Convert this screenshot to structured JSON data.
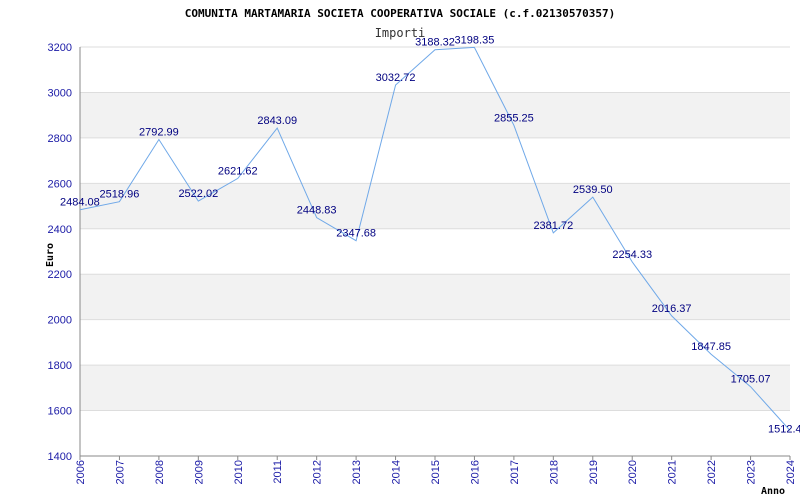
{
  "chart_data": {
    "type": "line",
    "title": "COMUNITA MARTAMARIA SOCIETA COOPERATIVA SOCIALE (c.f.02130570357)",
    "subtitle": "Importi",
    "xlabel": "Anno",
    "ylabel": "Euro",
    "ylim": [
      1400,
      3200
    ],
    "yticks": [
      1400,
      1600,
      1800,
      2000,
      2200,
      2400,
      2600,
      2800,
      3000,
      3200
    ],
    "grid": true,
    "x": [
      "2006",
      "2007",
      "2008",
      "2009",
      "2010",
      "2011",
      "2012",
      "2013",
      "2014",
      "2015",
      "2016",
      "2017",
      "2018",
      "2019",
      "2020",
      "2021",
      "2022",
      "2023",
      "2024"
    ],
    "series": [
      {
        "values": [
          2484.08,
          2518.96,
          2792.99,
          2522.02,
          2621.62,
          2843.09,
          2448.83,
          2347.68,
          3032.72,
          3188.32,
          3198.35,
          2855.25,
          2381.72,
          2539.5,
          2254.33,
          2016.37,
          1847.85,
          1705.07,
          1512.4
        ],
        "labels": [
          "2484.08",
          "2518.96",
          "2792.99",
          "2522.02",
          "2621.62",
          "2843.09",
          "2448.83",
          "2347.68",
          "3032.72",
          "3188.32",
          "3198.35",
          "2855.25",
          "2381.72",
          "2539.50",
          "2254.33",
          "2016.37",
          "1847.85",
          "1705.07",
          "1512.4"
        ]
      }
    ],
    "colors": {
      "line": "#6fa8e8",
      "band": "#f2f2f2",
      "grid": "#dddddd",
      "axis": "#888888",
      "tick_text": "#1a1aa6",
      "data_label": "#000080"
    }
  }
}
